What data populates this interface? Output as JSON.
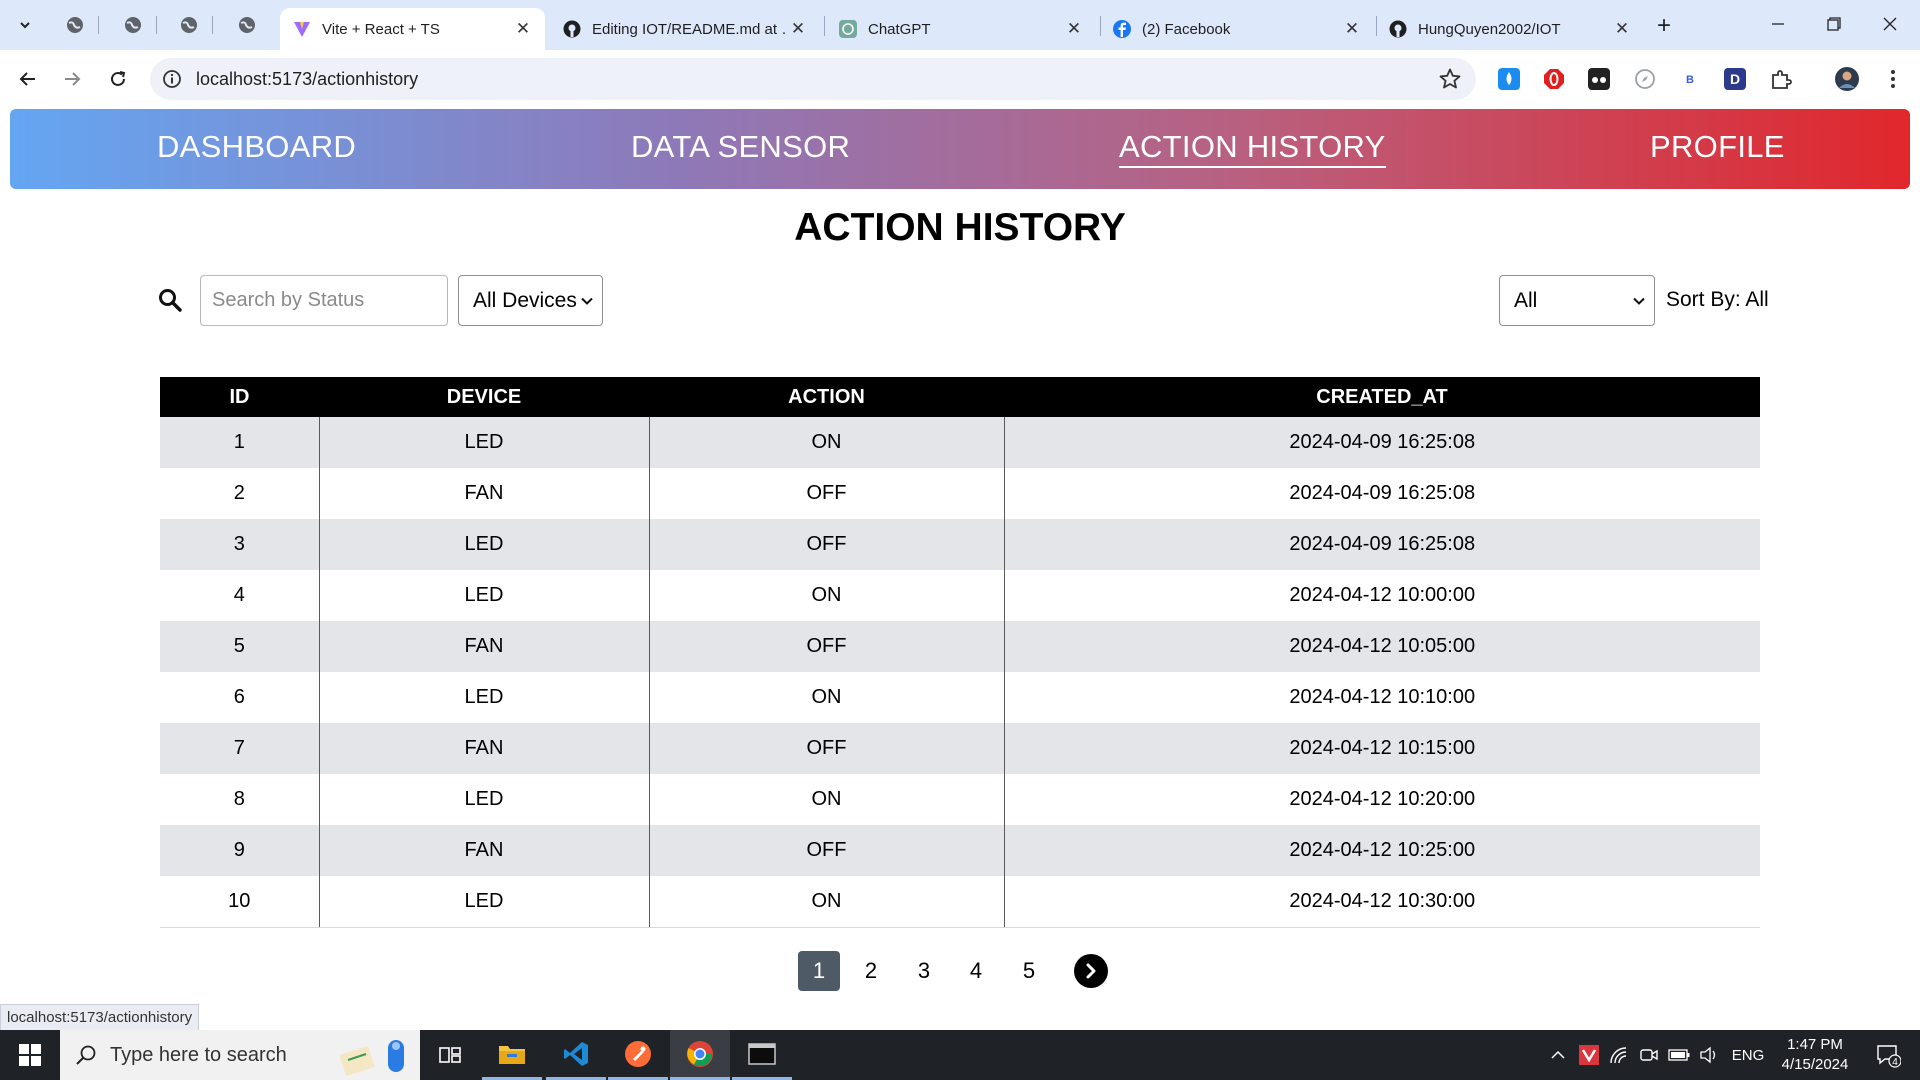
{
  "browser": {
    "tabs": [
      {
        "title": "Vite + React + TS",
        "active": true
      },
      {
        "title": "Editing IOT/README.md at …",
        "active": false
      },
      {
        "title": "ChatGPT",
        "active": false
      },
      {
        "title": "(2) Facebook",
        "active": false
      },
      {
        "title": "HungQuyen2002/IOT",
        "active": false
      }
    ],
    "url": "localhost:5173/actionhistory",
    "status_url": "localhost:5173/actionhistory"
  },
  "nav": {
    "items": [
      {
        "label": "DASHBOARD",
        "active": false
      },
      {
        "label": "DATA SENSOR",
        "active": false
      },
      {
        "label": "ACTION HISTORY",
        "active": true
      },
      {
        "label": "PROFILE",
        "active": false
      }
    ]
  },
  "page": {
    "title": "ACTION HISTORY",
    "search_placeholder": "Search by Status",
    "device_filter": "All Devices",
    "sort_select": "All",
    "sort_label": "Sort By: All"
  },
  "table": {
    "columns": [
      "ID",
      "DEVICE",
      "ACTION",
      "CREATED_AT"
    ],
    "rows": [
      [
        "1",
        "LED",
        "ON",
        "2024-04-09 16:25:08"
      ],
      [
        "2",
        "FAN",
        "OFF",
        "2024-04-09 16:25:08"
      ],
      [
        "3",
        "LED",
        "OFF",
        "2024-04-09 16:25:08"
      ],
      [
        "4",
        "LED",
        "ON",
        "2024-04-12 10:00:00"
      ],
      [
        "5",
        "FAN",
        "OFF",
        "2024-04-12 10:05:00"
      ],
      [
        "6",
        "LED",
        "ON",
        "2024-04-12 10:10:00"
      ],
      [
        "7",
        "FAN",
        "OFF",
        "2024-04-12 10:15:00"
      ],
      [
        "8",
        "LED",
        "ON",
        "2024-04-12 10:20:00"
      ],
      [
        "9",
        "FAN",
        "OFF",
        "2024-04-12 10:25:00"
      ],
      [
        "10",
        "LED",
        "ON",
        "2024-04-12 10:30:00"
      ]
    ]
  },
  "pagination": {
    "pages": [
      "1",
      "2",
      "3",
      "4",
      "5"
    ],
    "current": "1"
  },
  "taskbar": {
    "search_placeholder": "Type here to search",
    "language": "ENG",
    "time": "1:47 PM",
    "date": "4/15/2024",
    "notifications": "4"
  },
  "colors": {
    "nav_gradient_start": "#64a6f2",
    "nav_gradient_end": "#e1272c",
    "table_header": "#000000",
    "row_stripe": "#e4e5e9",
    "active_page": "#4f5a67"
  }
}
